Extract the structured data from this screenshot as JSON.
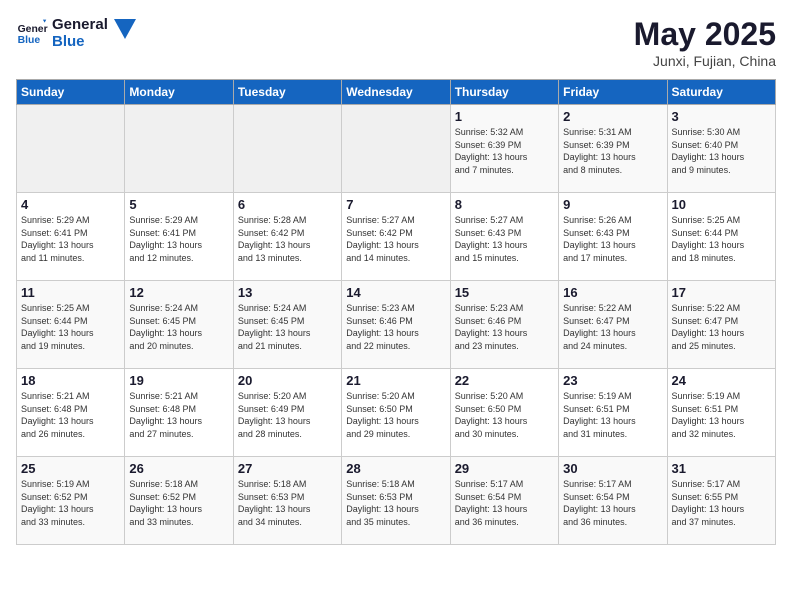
{
  "header": {
    "logo_general": "General",
    "logo_blue": "Blue",
    "month_title": "May 2025",
    "subtitle": "Junxi, Fujian, China"
  },
  "days_of_week": [
    "Sunday",
    "Monday",
    "Tuesday",
    "Wednesday",
    "Thursday",
    "Friday",
    "Saturday"
  ],
  "weeks": [
    [
      {
        "day": "",
        "detail": ""
      },
      {
        "day": "",
        "detail": ""
      },
      {
        "day": "",
        "detail": ""
      },
      {
        "day": "",
        "detail": ""
      },
      {
        "day": "1",
        "detail": "Sunrise: 5:32 AM\nSunset: 6:39 PM\nDaylight: 13 hours\nand 7 minutes."
      },
      {
        "day": "2",
        "detail": "Sunrise: 5:31 AM\nSunset: 6:39 PM\nDaylight: 13 hours\nand 8 minutes."
      },
      {
        "day": "3",
        "detail": "Sunrise: 5:30 AM\nSunset: 6:40 PM\nDaylight: 13 hours\nand 9 minutes."
      }
    ],
    [
      {
        "day": "4",
        "detail": "Sunrise: 5:29 AM\nSunset: 6:41 PM\nDaylight: 13 hours\nand 11 minutes."
      },
      {
        "day": "5",
        "detail": "Sunrise: 5:29 AM\nSunset: 6:41 PM\nDaylight: 13 hours\nand 12 minutes."
      },
      {
        "day": "6",
        "detail": "Sunrise: 5:28 AM\nSunset: 6:42 PM\nDaylight: 13 hours\nand 13 minutes."
      },
      {
        "day": "7",
        "detail": "Sunrise: 5:27 AM\nSunset: 6:42 PM\nDaylight: 13 hours\nand 14 minutes."
      },
      {
        "day": "8",
        "detail": "Sunrise: 5:27 AM\nSunset: 6:43 PM\nDaylight: 13 hours\nand 15 minutes."
      },
      {
        "day": "9",
        "detail": "Sunrise: 5:26 AM\nSunset: 6:43 PM\nDaylight: 13 hours\nand 17 minutes."
      },
      {
        "day": "10",
        "detail": "Sunrise: 5:25 AM\nSunset: 6:44 PM\nDaylight: 13 hours\nand 18 minutes."
      }
    ],
    [
      {
        "day": "11",
        "detail": "Sunrise: 5:25 AM\nSunset: 6:44 PM\nDaylight: 13 hours\nand 19 minutes."
      },
      {
        "day": "12",
        "detail": "Sunrise: 5:24 AM\nSunset: 6:45 PM\nDaylight: 13 hours\nand 20 minutes."
      },
      {
        "day": "13",
        "detail": "Sunrise: 5:24 AM\nSunset: 6:45 PM\nDaylight: 13 hours\nand 21 minutes."
      },
      {
        "day": "14",
        "detail": "Sunrise: 5:23 AM\nSunset: 6:46 PM\nDaylight: 13 hours\nand 22 minutes."
      },
      {
        "day": "15",
        "detail": "Sunrise: 5:23 AM\nSunset: 6:46 PM\nDaylight: 13 hours\nand 23 minutes."
      },
      {
        "day": "16",
        "detail": "Sunrise: 5:22 AM\nSunset: 6:47 PM\nDaylight: 13 hours\nand 24 minutes."
      },
      {
        "day": "17",
        "detail": "Sunrise: 5:22 AM\nSunset: 6:47 PM\nDaylight: 13 hours\nand 25 minutes."
      }
    ],
    [
      {
        "day": "18",
        "detail": "Sunrise: 5:21 AM\nSunset: 6:48 PM\nDaylight: 13 hours\nand 26 minutes."
      },
      {
        "day": "19",
        "detail": "Sunrise: 5:21 AM\nSunset: 6:48 PM\nDaylight: 13 hours\nand 27 minutes."
      },
      {
        "day": "20",
        "detail": "Sunrise: 5:20 AM\nSunset: 6:49 PM\nDaylight: 13 hours\nand 28 minutes."
      },
      {
        "day": "21",
        "detail": "Sunrise: 5:20 AM\nSunset: 6:50 PM\nDaylight: 13 hours\nand 29 minutes."
      },
      {
        "day": "22",
        "detail": "Sunrise: 5:20 AM\nSunset: 6:50 PM\nDaylight: 13 hours\nand 30 minutes."
      },
      {
        "day": "23",
        "detail": "Sunrise: 5:19 AM\nSunset: 6:51 PM\nDaylight: 13 hours\nand 31 minutes."
      },
      {
        "day": "24",
        "detail": "Sunrise: 5:19 AM\nSunset: 6:51 PM\nDaylight: 13 hours\nand 32 minutes."
      }
    ],
    [
      {
        "day": "25",
        "detail": "Sunrise: 5:19 AM\nSunset: 6:52 PM\nDaylight: 13 hours\nand 33 minutes."
      },
      {
        "day": "26",
        "detail": "Sunrise: 5:18 AM\nSunset: 6:52 PM\nDaylight: 13 hours\nand 33 minutes."
      },
      {
        "day": "27",
        "detail": "Sunrise: 5:18 AM\nSunset: 6:53 PM\nDaylight: 13 hours\nand 34 minutes."
      },
      {
        "day": "28",
        "detail": "Sunrise: 5:18 AM\nSunset: 6:53 PM\nDaylight: 13 hours\nand 35 minutes."
      },
      {
        "day": "29",
        "detail": "Sunrise: 5:17 AM\nSunset: 6:54 PM\nDaylight: 13 hours\nand 36 minutes."
      },
      {
        "day": "30",
        "detail": "Sunrise: 5:17 AM\nSunset: 6:54 PM\nDaylight: 13 hours\nand 36 minutes."
      },
      {
        "day": "31",
        "detail": "Sunrise: 5:17 AM\nSunset: 6:55 PM\nDaylight: 13 hours\nand 37 minutes."
      }
    ]
  ]
}
